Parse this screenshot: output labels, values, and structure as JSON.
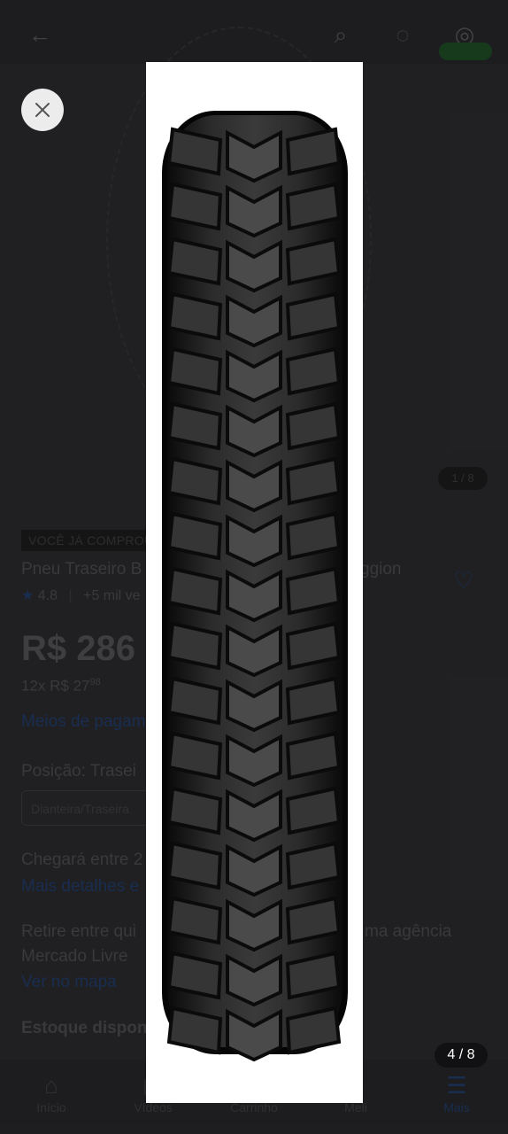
{
  "header": {
    "icons": [
      "back-arrow-icon",
      "search-icon",
      "chat-icon",
      "cart-icon"
    ]
  },
  "product": {
    "gallery_counter": "1 / 8",
    "badge": "VOCÊ JÁ COMPROU",
    "title_start": "Pneu Traseiro B",
    "title_end": "ggion",
    "rating": "4.8",
    "sold": "+5 mil ve",
    "price": "R$ 286",
    "installments_prefix": "12x R$ 27",
    "installments_cents": "98",
    "payment_link": "Meios de pagam",
    "position_label": "Posição: Trasei",
    "position_option": "Dianteira/Traseira",
    "delivery": "Chegará entre 2",
    "delivery_link": "Mais detalhes e",
    "pickup_line1_start": "Retire entre qui",
    "pickup_line1_end": "ma agência",
    "pickup_line2": "Mercado Livre",
    "map_link": "Ver no mapa",
    "stock": "Estoque dispon"
  },
  "tabbar": {
    "items": [
      {
        "label": "Início",
        "icon": "home-icon"
      },
      {
        "label": "Vídeos",
        "icon": "video-icon"
      },
      {
        "label": "Carrinho",
        "icon": "cart-icon"
      },
      {
        "label": "Meli",
        "icon": "meli-icon"
      },
      {
        "label": "Mais",
        "icon": "menu-icon"
      }
    ]
  },
  "viewer": {
    "image": "motorcycle-tire-tread",
    "pager": "4 / 8",
    "close_icon": "close-icon"
  },
  "colors": {
    "accent": "#3483fa",
    "overlay": "#1c1c1f",
    "viewer_bg": "#ffffff"
  }
}
